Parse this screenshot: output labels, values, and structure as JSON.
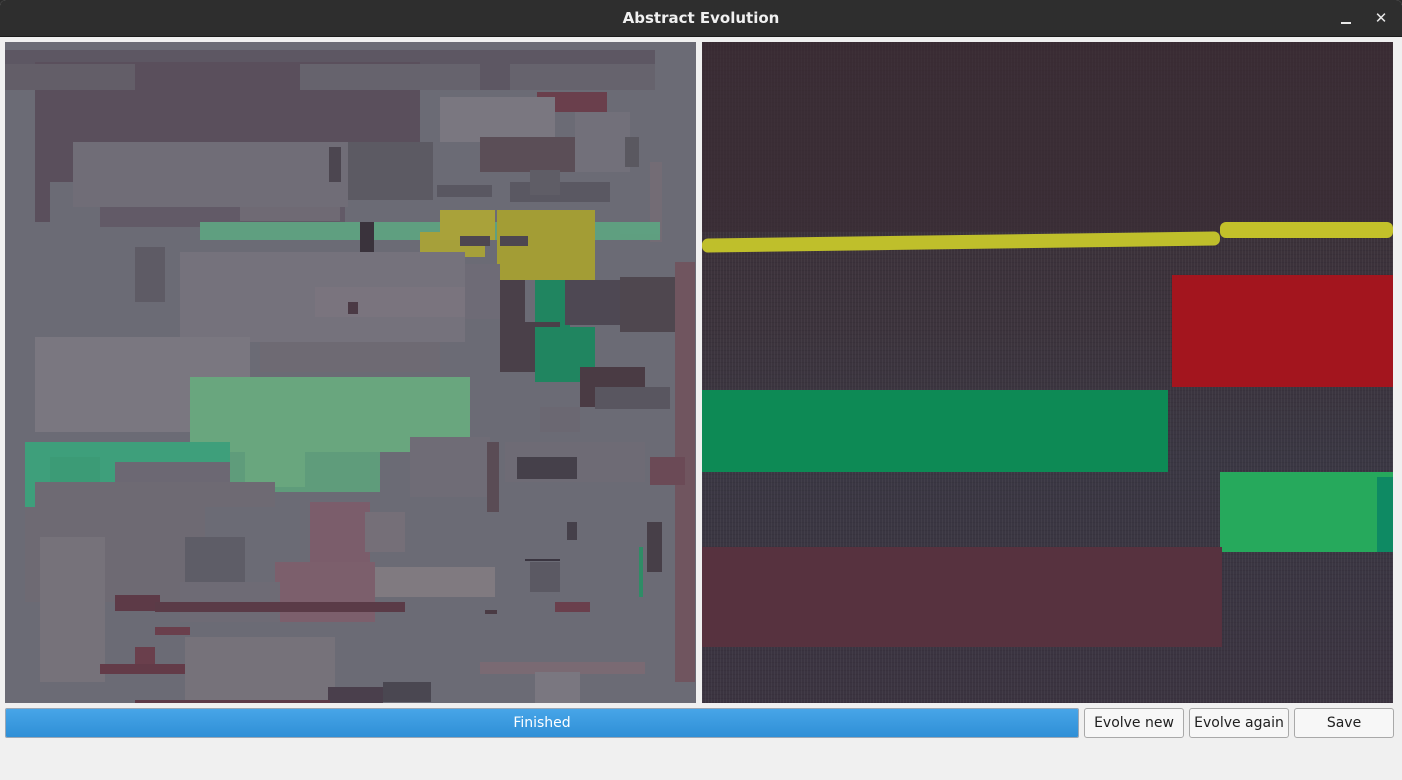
{
  "window": {
    "title": "Abstract Evolution",
    "minimize_icon": "minimize-icon",
    "close_icon": "close-icon",
    "close_glyph": "✕"
  },
  "canvases": {
    "evolved_label": "evolved-canvas",
    "target_label": "target-canvas"
  },
  "controls": {
    "progress_text": "Finished",
    "progress_value": 1.0,
    "evolve_new_label": "Evolve new",
    "evolve_again_label": "Evolve again",
    "save_label": "Save"
  },
  "colors": {
    "progress_fill": "#2f8fd6",
    "titlebar": "#2e2e2e"
  }
}
